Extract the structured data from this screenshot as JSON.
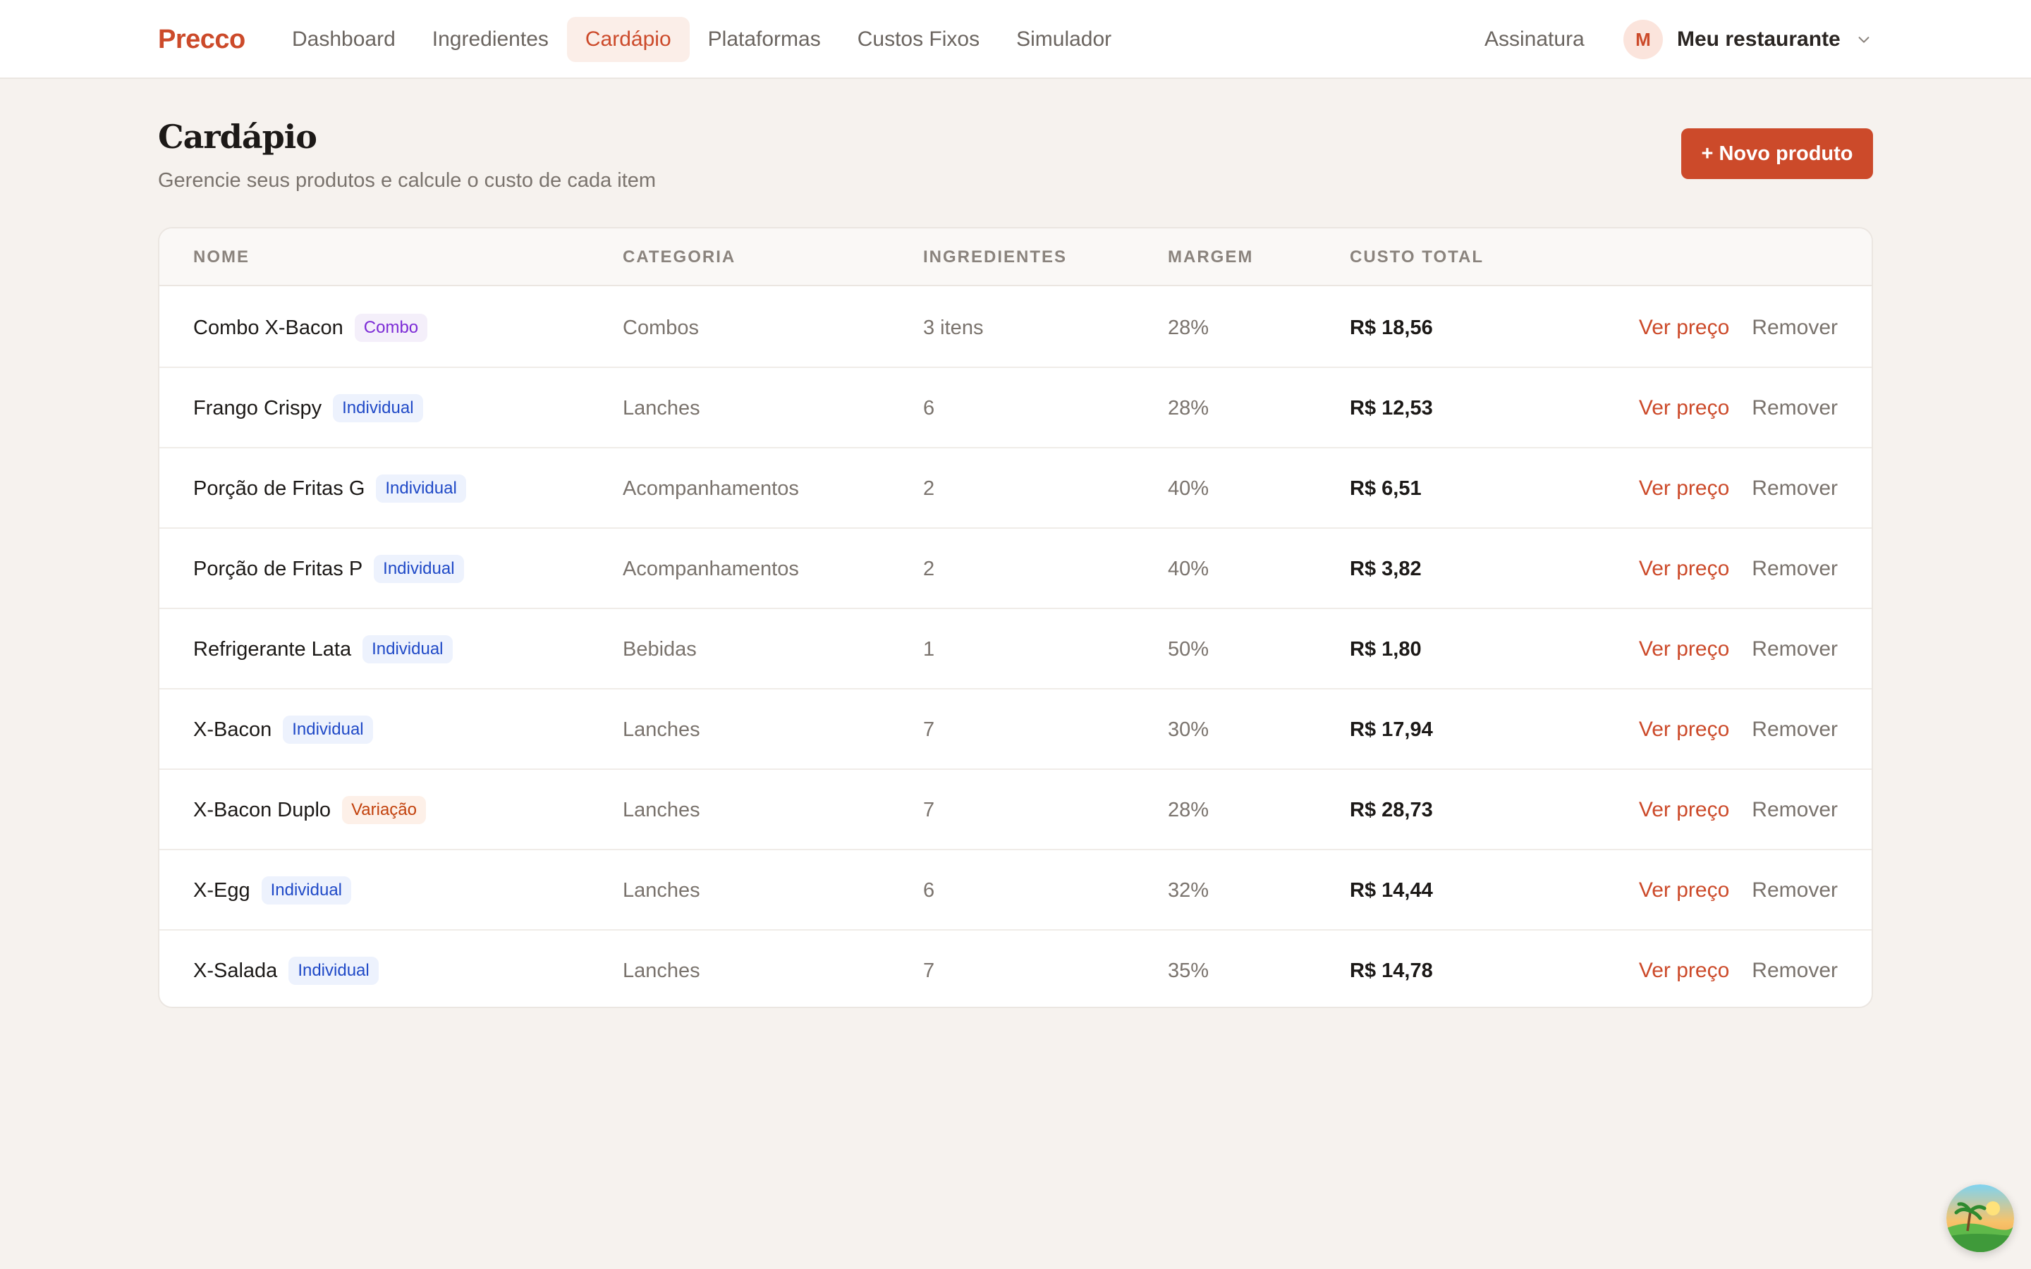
{
  "app": {
    "brand": "Precco"
  },
  "nav": {
    "items": [
      {
        "label": "Dashboard",
        "active": false
      },
      {
        "label": "Ingredientes",
        "active": false
      },
      {
        "label": "Cardápio",
        "active": true
      },
      {
        "label": "Plataformas",
        "active": false
      },
      {
        "label": "Custos Fixos",
        "active": false
      },
      {
        "label": "Simulador",
        "active": false
      }
    ],
    "subscription": "Assinatura",
    "account": {
      "avatar_initial": "M",
      "name": "Meu restaurante",
      "icon": "chevron-down-icon"
    }
  },
  "header": {
    "title": "Cardápio",
    "subtitle": "Gerencie seus produtos e calcule o custo de cada item",
    "new_button": "+ Novo produto"
  },
  "table": {
    "columns": [
      "NOME",
      "CATEGORIA",
      "INGREDIENTES",
      "MARGEM",
      "CUSTO TOTAL"
    ],
    "action_labels": {
      "price": "Ver preço",
      "remove": "Remover"
    },
    "rows": [
      {
        "name": "Combo X-Bacon",
        "type": "Combo",
        "type_class": "combo",
        "category": "Combos",
        "ingredients": "3 itens",
        "margin": "28%",
        "cost": "R$ 18,56"
      },
      {
        "name": "Frango Crispy",
        "type": "Individual",
        "type_class": "individual",
        "category": "Lanches",
        "ingredients": "6",
        "margin": "28%",
        "cost": "R$ 12,53"
      },
      {
        "name": "Porção de Fritas G",
        "type": "Individual",
        "type_class": "individual",
        "category": "Acompanhamentos",
        "ingredients": "2",
        "margin": "40%",
        "cost": "R$ 6,51"
      },
      {
        "name": "Porção de Fritas P",
        "type": "Individual",
        "type_class": "individual",
        "category": "Acompanhamentos",
        "ingredients": "2",
        "margin": "40%",
        "cost": "R$ 3,82"
      },
      {
        "name": "Refrigerante Lata",
        "type": "Individual",
        "type_class": "individual",
        "category": "Bebidas",
        "ingredients": "1",
        "margin": "50%",
        "cost": "R$ 1,80"
      },
      {
        "name": "X-Bacon",
        "type": "Individual",
        "type_class": "individual",
        "category": "Lanches",
        "ingredients": "7",
        "margin": "30%",
        "cost": "R$ 17,94"
      },
      {
        "name": "X-Bacon Duplo",
        "type": "Variação",
        "type_class": "variacao",
        "category": "Lanches",
        "ingredients": "7",
        "margin": "28%",
        "cost": "R$ 28,73"
      },
      {
        "name": "X-Egg",
        "type": "Individual",
        "type_class": "individual",
        "category": "Lanches",
        "ingredients": "6",
        "margin": "32%",
        "cost": "R$ 14,44"
      },
      {
        "name": "X-Salada",
        "type": "Individual",
        "type_class": "individual",
        "category": "Lanches",
        "ingredients": "7",
        "margin": "35%",
        "cost": "R$ 14,78"
      }
    ]
  },
  "colors": {
    "accent": "#cc4a2a",
    "background": "#f6f2ee",
    "badge_combo": "#7c2bd6",
    "badge_individual": "#1f49c7",
    "badge_variacao": "#c2410c"
  },
  "widget": {
    "icon": "beach-landscape-icon"
  }
}
